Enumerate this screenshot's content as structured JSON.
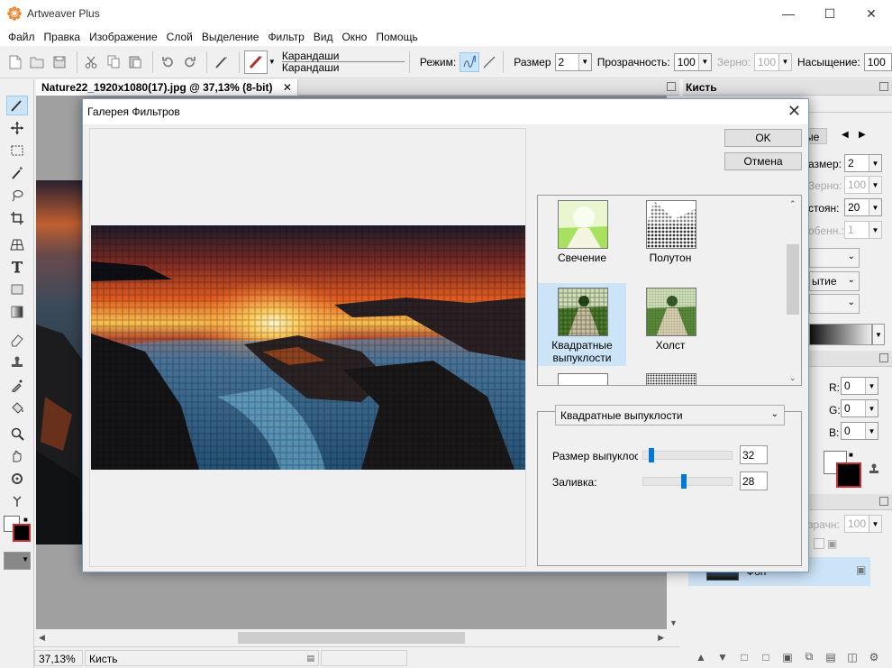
{
  "app": {
    "title": "Artweaver Plus"
  },
  "menu": [
    "Файл",
    "Правка",
    "Изображение",
    "Слой",
    "Выделение",
    "Фильтр",
    "Вид",
    "Окно",
    "Помощь"
  ],
  "toolbar": {
    "preset_line1": "Карандаши",
    "preset_line2": "Карандаши",
    "mode_label": "Режим:",
    "size_label": "Размер",
    "size_value": "2",
    "opacity_label": "Прозрачность:",
    "opacity_value": "100",
    "grain_label": "Зерно:",
    "grain_value": "100",
    "saturation_label": "Насыщение:",
    "saturation_value": "100"
  },
  "document": {
    "tab": "Nature22_1920x1080(17).jpg @ 37,13% (8-bit)",
    "close": "✕"
  },
  "status": {
    "zoom": "37,13%",
    "tool": "Кисть"
  },
  "panel_brush": {
    "title": "Кисть",
    "tab_partial": "ые",
    "size_label": "азмер:",
    "size_value": "2",
    "grain_label": "Зерно:",
    "grain_value": "100",
    "spacing_label": "стоян:",
    "spacing_value": "20",
    "smooth_label": "обенн.:",
    "smooth_value": "1",
    "drop_partial": "ытие"
  },
  "panel_color": {
    "r_label": "R:",
    "r": "0",
    "g_label": "G:",
    "g": "0",
    "b_label": "B:",
    "b": "0"
  },
  "panel_layers": {
    "opacity_label": "зрачн:",
    "opacity_value": "100",
    "layer_name": "Фон"
  },
  "dialog": {
    "title": "Галерея Фильтров",
    "ok": "OK",
    "cancel": "Отмена",
    "filters": [
      {
        "name": "Свечение",
        "selected": false
      },
      {
        "name": "Полутон",
        "selected": false
      },
      {
        "name": "Квадратные выпуклости",
        "selected": true
      },
      {
        "name": "Холст",
        "selected": false
      }
    ],
    "selected_filter": "Квадратные выпуклости",
    "params": [
      {
        "label": "Размер выпуклос",
        "value": "32",
        "fraction": 0.06
      },
      {
        "label": "Заливка:",
        "value": "28",
        "fraction": 0.45
      }
    ]
  }
}
